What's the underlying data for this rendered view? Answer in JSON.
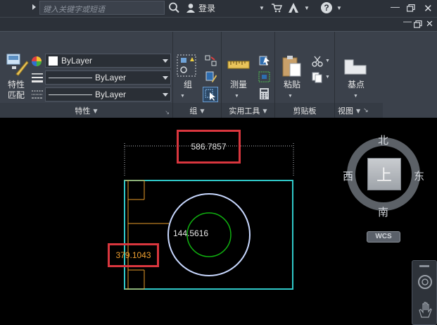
{
  "titlebar": {
    "search_placeholder": "键入关键字或短语",
    "login_label": "登录",
    "icons": [
      "search-icon",
      "user-icon",
      "cart-icon",
      "a360-icon",
      "help-icon"
    ]
  },
  "ribbon": {
    "properties": {
      "match_label_line1": "特性",
      "match_label_line2": "匹配",
      "color_value": "ByLayer",
      "linetype_value": "ByLayer",
      "lineweight_value": "ByLayer",
      "panel_title": "特性"
    },
    "group": {
      "button_label": "组",
      "panel_title": "组"
    },
    "utilities": {
      "measure_label": "测量",
      "panel_title": "实用工具"
    },
    "clipboard": {
      "paste_label": "粘贴",
      "panel_title": "剪贴板"
    },
    "view": {
      "base_label": "基点",
      "panel_title": "视图"
    }
  },
  "drawing": {
    "colors": {
      "rectangle": "#30c8c8",
      "outer_circle": "#c8d8ff",
      "inner_circle": "#10b010",
      "leader": "#e89c2a",
      "highlight": "#d9363e"
    },
    "width_dimension": "586.7857",
    "height_dimension": "379.1043",
    "diameter_dimension": "144.5616"
  },
  "viewcube": {
    "north": "北",
    "south": "南",
    "east": "东",
    "west": "西",
    "face": "上",
    "wcs_label": "WCS"
  }
}
